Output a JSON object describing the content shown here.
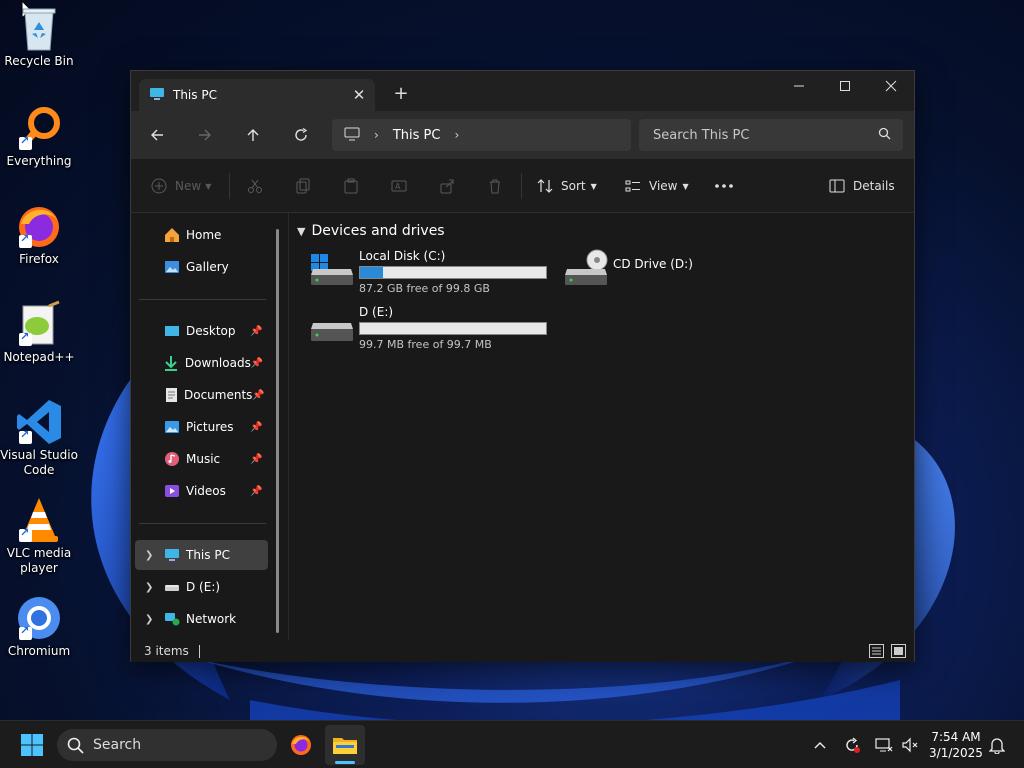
{
  "desktop": {
    "icons": [
      {
        "label": "Recycle Bin",
        "icon": "recycle-bin-icon"
      },
      {
        "label": "Everything",
        "icon": "everything-search-icon"
      },
      {
        "label": "Firefox",
        "icon": "firefox-icon"
      },
      {
        "label": "Notepad++",
        "icon": "notepad-plus-plus-icon"
      },
      {
        "label": "Visual Studio Code",
        "icon": "vscode-icon"
      },
      {
        "label": "VLC media player",
        "icon": "vlc-icon"
      },
      {
        "label": "Chromium",
        "icon": "chromium-icon"
      }
    ]
  },
  "window": {
    "tab_title": "This PC",
    "breadcrumb": "This PC",
    "search_placeholder": "Search This PC",
    "commands": {
      "new": "New",
      "sort": "Sort",
      "view": "View",
      "details": "Details"
    },
    "sidebar": {
      "top": [
        {
          "label": "Home",
          "icon": "home-icon"
        },
        {
          "label": "Gallery",
          "icon": "gallery-icon"
        }
      ],
      "pinned": [
        {
          "label": "Desktop",
          "icon": "desktop-folder-icon"
        },
        {
          "label": "Downloads",
          "icon": "downloads-icon"
        },
        {
          "label": "Documents",
          "icon": "documents-icon"
        },
        {
          "label": "Pictures",
          "icon": "pictures-icon"
        },
        {
          "label": "Music",
          "icon": "music-icon"
        },
        {
          "label": "Videos",
          "icon": "videos-icon"
        }
      ],
      "tree": [
        {
          "label": "This PC",
          "icon": "this-pc-icon",
          "selected": true
        },
        {
          "label": "D (E:)",
          "icon": "drive-icon"
        },
        {
          "label": "Network",
          "icon": "network-icon"
        }
      ]
    },
    "group_title": "Devices and drives",
    "drives": [
      {
        "name": "Local Disk (C:)",
        "free_text": "87.2 GB free of 99.8 GB",
        "used_fraction": 0.126
      },
      {
        "name": "CD Drive (D:)"
      },
      {
        "name": "D (E:)",
        "free_text": "99.7 MB free of 99.7 MB",
        "used_fraction": 0.0
      }
    ],
    "status": {
      "item_count": "3 items"
    }
  },
  "taskbar": {
    "search_placeholder": "Search",
    "time": "7:54 AM",
    "date": "3/1/2025"
  },
  "colors": {
    "accent": "#2a8ad8",
    "window_bg": "#191919",
    "selected": "#404040"
  }
}
